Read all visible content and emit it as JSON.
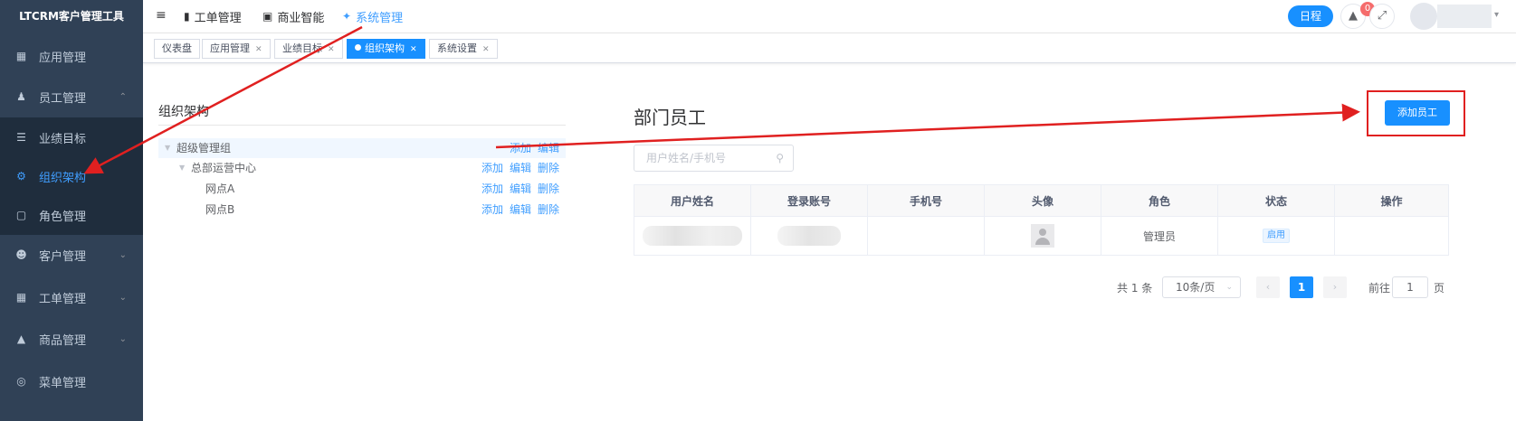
{
  "brand": "LTCRM客户管理工具",
  "sidebar": {
    "items": [
      {
        "label": "应用管理",
        "icon": "grid-icon"
      },
      {
        "label": "员工管理",
        "icon": "user-icon"
      },
      {
        "label": "业绩目标",
        "icon": "list-icon"
      },
      {
        "label": "组织架构",
        "icon": "org-icon"
      },
      {
        "label": "角色管理",
        "icon": "role-icon"
      },
      {
        "label": "客户管理",
        "icon": "customer-icon"
      },
      {
        "label": "工单管理",
        "icon": "clipboard-icon"
      },
      {
        "label": "商品管理",
        "icon": "box-icon"
      },
      {
        "label": "菜单管理",
        "icon": "menu-icon"
      }
    ]
  },
  "topnav": {
    "menus": [
      "工单管理",
      "商业智能",
      "系统管理"
    ],
    "schedule_label": "日程",
    "notification_count": "0"
  },
  "tags": [
    "仪表盘",
    "应用管理",
    "业绩目标",
    "组织架构",
    "系统设置"
  ],
  "org": {
    "title": "组织架构",
    "nodes": [
      {
        "label": "超级管理组",
        "actions": [
          "添加",
          "编辑"
        ]
      },
      {
        "label": "总部运营中心",
        "actions": [
          "添加",
          "编辑",
          "删除"
        ]
      },
      {
        "label": "网点A",
        "actions": [
          "添加",
          "编辑",
          "删除"
        ]
      },
      {
        "label": "网点B",
        "actions": [
          "添加",
          "编辑",
          "删除"
        ]
      }
    ]
  },
  "dept": {
    "title": "部门员工",
    "add_button": "添加员工",
    "search_placeholder": "用户姓名/手机号",
    "columns": [
      "用户姓名",
      "登录账号",
      "手机号",
      "头像",
      "角色",
      "状态",
      "操作"
    ],
    "rows": [
      {
        "role": "管理员",
        "status": "启用"
      }
    ]
  },
  "pagination": {
    "total": "共 1 条",
    "page_size": "10条/页",
    "current": "1",
    "goto_label": "前往",
    "goto_value": "1",
    "page_unit": "页"
  },
  "colors": {
    "sidebar_bg": "#304156",
    "accent": "#1890ff",
    "annotation": "#e02020"
  }
}
